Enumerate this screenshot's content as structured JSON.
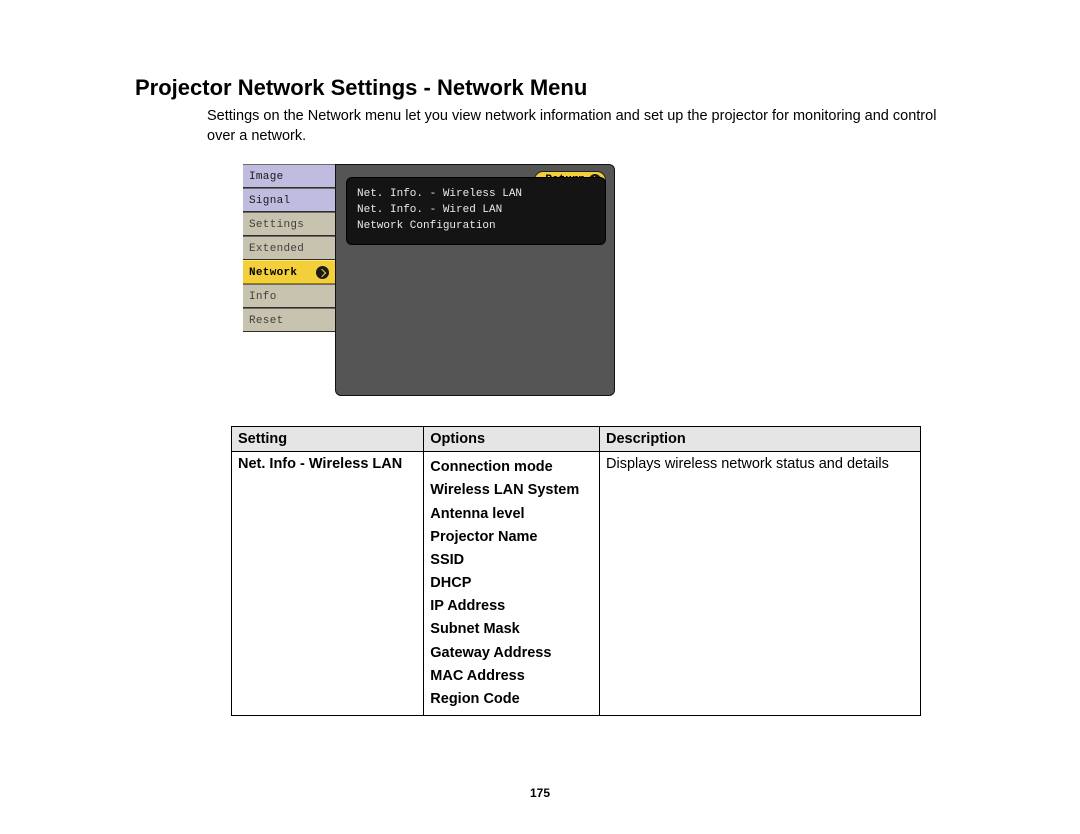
{
  "title": "Projector Network Settings - Network Menu",
  "intro": "Settings on the Network menu let you view network information and set up the projector for monitoring and control over a network.",
  "osd": {
    "sidebar": [
      {
        "label": "Image",
        "style": "norm"
      },
      {
        "label": "Signal",
        "style": "norm"
      },
      {
        "label": "Settings",
        "style": "dim"
      },
      {
        "label": "Extended",
        "style": "dim"
      },
      {
        "label": "Network",
        "style": "sel"
      },
      {
        "label": "Info",
        "style": "dim"
      },
      {
        "label": "Reset",
        "style": "dim"
      }
    ],
    "return_label": "Return",
    "panel_items": [
      "Net. Info. - Wireless LAN",
      "Net. Info. - Wired LAN",
      "Network Configuration"
    ]
  },
  "table": {
    "headers": {
      "col1": "Setting",
      "col2": "Options",
      "col3": "Description"
    },
    "row1": {
      "setting": "Net. Info - Wireless LAN",
      "options": [
        "Connection mode",
        "Wireless LAN System",
        "Antenna level",
        "Projector Name",
        "SSID",
        "DHCP",
        "IP Address",
        "Subnet Mask",
        "Gateway Address",
        "MAC Address",
        "Region Code"
      ],
      "description": "Displays wireless network status and details"
    }
  },
  "page_number": "175"
}
